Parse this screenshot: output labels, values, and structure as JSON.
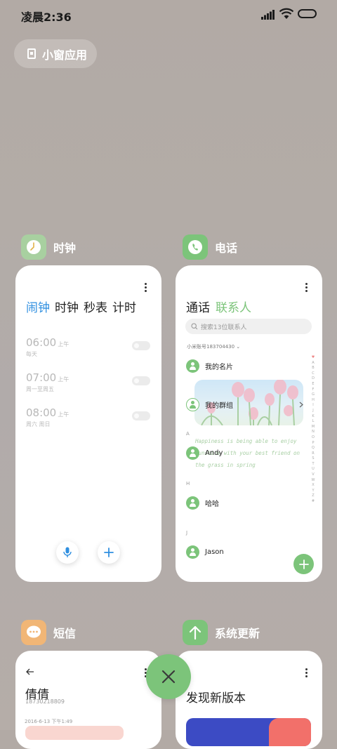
{
  "status_bar": {
    "time": "凌晨2:36"
  },
  "small_window": {
    "label": "小窗应用"
  },
  "apps": {
    "clock": {
      "name": "时钟",
      "tabs": [
        "闹钟",
        "时钟",
        "秒表",
        "计时"
      ],
      "active_tab": "闹钟",
      "alarms": [
        {
          "time": "06:00",
          "period": "上午",
          "repeat": "每天",
          "enabled": false
        },
        {
          "time": "07:00",
          "period": "上午",
          "repeat": "周一至周五",
          "enabled": false
        },
        {
          "time": "08:00",
          "period": "上午",
          "repeat": "周六 周日",
          "enabled": false
        }
      ]
    },
    "phone": {
      "name": "电话",
      "tabs": [
        "通话",
        "联系人"
      ],
      "active_tab": "联系人",
      "search_placeholder": "搜索13位联系人",
      "account": "小米账号183704430 ⌄",
      "my_card": "我的名片",
      "my_groups": "我的群组",
      "sections": [
        {
          "letter": "A",
          "contact": "Andy"
        },
        {
          "letter": "H",
          "contact": "哈哈"
        },
        {
          "letter": "J",
          "contact": "Jason"
        }
      ],
      "index": [
        "♥",
        "A",
        "B",
        "C",
        "D",
        "E",
        "F",
        "G",
        "H",
        "I",
        "J",
        "K",
        "L",
        "M",
        "N",
        "O",
        "P",
        "Q",
        "R",
        "S",
        "T",
        "U",
        "V",
        "W",
        "X",
        "Y",
        "Z",
        "#"
      ],
      "banner_quote": "Happiness is being able to enjoy sunshine with your best friend on the grass in spring"
    },
    "sms": {
      "name": "短信",
      "contact": "倩倩",
      "number": "18730218809",
      "date": "2016-6-13 下午1:49"
    },
    "update": {
      "name": "系统更新",
      "title": "发现新版本"
    }
  },
  "colors": {
    "accent_green": "#7cc47a",
    "accent_blue": "#2f8fe0",
    "sms_orange": "#f1b676"
  }
}
